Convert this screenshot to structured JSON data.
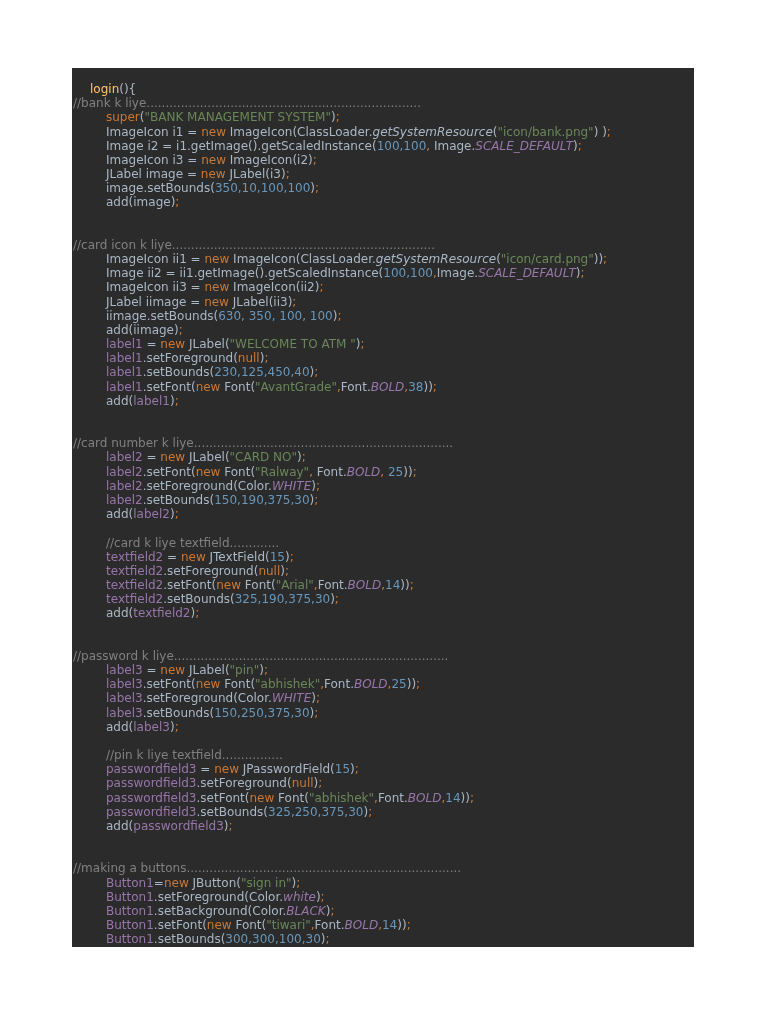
{
  "editor": {
    "lines": [
      {
        "kind": "header",
        "tokens": [
          {
            "kind": "function",
            "text": "login"
          },
          {
            "kind": "plain",
            "text": "(){"
          }
        ]
      },
      {
        "kind": "comment",
        "tokens": [
          {
            "kind": "comment",
            "text": "//bank k liye........................................................................"
          }
        ]
      },
      {
        "kind": "code",
        "tokens": [
          {
            "kind": "keyword",
            "text": "super"
          },
          {
            "kind": "plain",
            "text": "("
          },
          {
            "kind": "string",
            "text": "\"BANK MANAGEMENT SYSTEM\""
          },
          {
            "kind": "plain",
            "text": ")"
          },
          {
            "kind": "punct",
            "text": ";"
          }
        ]
      },
      {
        "kind": "code",
        "tokens": [
          {
            "kind": "plain",
            "text": "ImageIcon i1 = "
          },
          {
            "kind": "keyword",
            "text": "new"
          },
          {
            "kind": "plain",
            "text": " ImageIcon(ClassLoader."
          },
          {
            "kind": "method",
            "text": "getSystemResource"
          },
          {
            "kind": "plain",
            "text": "("
          },
          {
            "kind": "string",
            "text": "\"icon/bank.png\""
          },
          {
            "kind": "plain",
            "text": ") )"
          },
          {
            "kind": "punct",
            "text": ";"
          }
        ]
      },
      {
        "kind": "code",
        "tokens": [
          {
            "kind": "plain",
            "text": "Image i2 = i1.getImage().getScaledInstance("
          },
          {
            "kind": "number",
            "text": "100,100"
          },
          {
            "kind": "punct",
            "text": ","
          },
          {
            "kind": "plain",
            "text": " Image."
          },
          {
            "kind": "constant",
            "text": "SCALE_DEFAULT"
          },
          {
            "kind": "plain",
            "text": ")"
          },
          {
            "kind": "punct",
            "text": ";"
          }
        ]
      },
      {
        "kind": "code",
        "tokens": [
          {
            "kind": "plain",
            "text": "ImageIcon i3 = "
          },
          {
            "kind": "keyword",
            "text": "new"
          },
          {
            "kind": "plain",
            "text": " ImageIcon(i2)"
          },
          {
            "kind": "punct",
            "text": ";"
          }
        ]
      },
      {
        "kind": "code",
        "tokens": [
          {
            "kind": "plain",
            "text": "JLabel image = "
          },
          {
            "kind": "keyword",
            "text": "new"
          },
          {
            "kind": "plain",
            "text": " JLabel(i3)"
          },
          {
            "kind": "punct",
            "text": ";"
          }
        ]
      },
      {
        "kind": "code",
        "tokens": [
          {
            "kind": "plain",
            "text": "image.setBounds("
          },
          {
            "kind": "number",
            "text": "350,10,100,100"
          },
          {
            "kind": "plain",
            "text": ")"
          },
          {
            "kind": "punct",
            "text": ";"
          }
        ]
      },
      {
        "kind": "code",
        "tokens": [
          {
            "kind": "plain",
            "text": "add(image)"
          },
          {
            "kind": "punct",
            "text": ";"
          }
        ]
      },
      {
        "kind": "blank"
      },
      {
        "kind": "blank"
      },
      {
        "kind": "comment",
        "tokens": [
          {
            "kind": "comment",
            "text": "//card icon k liye....................................................................."
          }
        ]
      },
      {
        "kind": "code",
        "tokens": [
          {
            "kind": "plain",
            "text": "ImageIcon ii1 = "
          },
          {
            "kind": "keyword",
            "text": "new"
          },
          {
            "kind": "plain",
            "text": " ImageIcon(ClassLoader."
          },
          {
            "kind": "method",
            "text": "getSystemResource"
          },
          {
            "kind": "plain",
            "text": "("
          },
          {
            "kind": "string",
            "text": "\"icon/card.png\""
          },
          {
            "kind": "plain",
            "text": "))"
          },
          {
            "kind": "punct",
            "text": ";"
          }
        ]
      },
      {
        "kind": "code",
        "tokens": [
          {
            "kind": "plain",
            "text": "Image ii2 = ii1.getImage().getScaledInstance("
          },
          {
            "kind": "number",
            "text": "100,100"
          },
          {
            "kind": "punct",
            "text": ","
          },
          {
            "kind": "plain",
            "text": "Image."
          },
          {
            "kind": "constant",
            "text": "SCALE_DEFAULT"
          },
          {
            "kind": "plain",
            "text": ")"
          },
          {
            "kind": "punct",
            "text": ";"
          }
        ]
      },
      {
        "kind": "code",
        "tokens": [
          {
            "kind": "plain",
            "text": "ImageIcon ii3 = "
          },
          {
            "kind": "keyword",
            "text": "new"
          },
          {
            "kind": "plain",
            "text": " ImageIcon(ii2)"
          },
          {
            "kind": "punct",
            "text": ";"
          }
        ]
      },
      {
        "kind": "code",
        "tokens": [
          {
            "kind": "plain",
            "text": "JLabel iimage = "
          },
          {
            "kind": "keyword",
            "text": "new"
          },
          {
            "kind": "plain",
            "text": " JLabel(ii3)"
          },
          {
            "kind": "punct",
            "text": ";"
          }
        ]
      },
      {
        "kind": "code",
        "tokens": [
          {
            "kind": "plain",
            "text": "iimage.setBounds("
          },
          {
            "kind": "number",
            "text": "630, 350, 100, 100"
          },
          {
            "kind": "plain",
            "text": ")"
          },
          {
            "kind": "punct",
            "text": ";"
          }
        ]
      },
      {
        "kind": "code",
        "tokens": [
          {
            "kind": "plain",
            "text": "add(iimage)"
          },
          {
            "kind": "punct",
            "text": ";"
          }
        ]
      },
      {
        "kind": "code",
        "tokens": [
          {
            "kind": "field",
            "text": "label1"
          },
          {
            "kind": "plain",
            "text": " = "
          },
          {
            "kind": "keyword",
            "text": "new"
          },
          {
            "kind": "plain",
            "text": " JLabel("
          },
          {
            "kind": "string",
            "text": "\"WELCOME TO ATM \""
          },
          {
            "kind": "plain",
            "text": ")"
          },
          {
            "kind": "punct",
            "text": ";"
          }
        ]
      },
      {
        "kind": "code",
        "tokens": [
          {
            "kind": "field",
            "text": "label1"
          },
          {
            "kind": "plain",
            "text": ".setForeground("
          },
          {
            "kind": "keyword",
            "text": "null"
          },
          {
            "kind": "plain",
            "text": ")"
          },
          {
            "kind": "punct",
            "text": ";"
          }
        ]
      },
      {
        "kind": "code",
        "tokens": [
          {
            "kind": "field",
            "text": "label1"
          },
          {
            "kind": "plain",
            "text": ".setBounds("
          },
          {
            "kind": "number",
            "text": "230,125,450,40"
          },
          {
            "kind": "plain",
            "text": ")"
          },
          {
            "kind": "punct",
            "text": ";"
          }
        ]
      },
      {
        "kind": "code",
        "tokens": [
          {
            "kind": "field",
            "text": "label1"
          },
          {
            "kind": "plain",
            "text": ".setFont("
          },
          {
            "kind": "keyword",
            "text": "new"
          },
          {
            "kind": "plain",
            "text": " Font("
          },
          {
            "kind": "string",
            "text": "\"AvantGrade\""
          },
          {
            "kind": "punct",
            "text": ","
          },
          {
            "kind": "plain",
            "text": "Font."
          },
          {
            "kind": "constant",
            "text": "BOLD"
          },
          {
            "kind": "punct",
            "text": ","
          },
          {
            "kind": "number",
            "text": "38"
          },
          {
            "kind": "plain",
            "text": "))"
          },
          {
            "kind": "punct",
            "text": ";"
          }
        ]
      },
      {
        "kind": "code",
        "tokens": [
          {
            "kind": "plain",
            "text": "add("
          },
          {
            "kind": "field",
            "text": "label1"
          },
          {
            "kind": "plain",
            "text": ")"
          },
          {
            "kind": "punct",
            "text": ";"
          }
        ]
      },
      {
        "kind": "blank"
      },
      {
        "kind": "blank"
      },
      {
        "kind": "comment",
        "tokens": [
          {
            "kind": "comment",
            "text": "//card number k liye...................................................................."
          }
        ]
      },
      {
        "kind": "code",
        "tokens": [
          {
            "kind": "field",
            "text": "label2"
          },
          {
            "kind": "plain",
            "text": " = "
          },
          {
            "kind": "keyword",
            "text": "new"
          },
          {
            "kind": "plain",
            "text": " JLabel("
          },
          {
            "kind": "string",
            "text": "\"CARD NO\""
          },
          {
            "kind": "plain",
            "text": ")"
          },
          {
            "kind": "punct",
            "text": ";"
          }
        ]
      },
      {
        "kind": "code",
        "tokens": [
          {
            "kind": "field",
            "text": "label2"
          },
          {
            "kind": "plain",
            "text": ".setFont("
          },
          {
            "kind": "keyword",
            "text": "new"
          },
          {
            "kind": "plain",
            "text": " Font("
          },
          {
            "kind": "string",
            "text": "\"Ralway\""
          },
          {
            "kind": "punct",
            "text": ","
          },
          {
            "kind": "plain",
            "text": " Font."
          },
          {
            "kind": "constant",
            "text": "BOLD"
          },
          {
            "kind": "punct",
            "text": ","
          },
          {
            "kind": "number",
            "text": " 25"
          },
          {
            "kind": "plain",
            "text": "))"
          },
          {
            "kind": "punct",
            "text": ";"
          }
        ]
      },
      {
        "kind": "code",
        "tokens": [
          {
            "kind": "field",
            "text": "label2"
          },
          {
            "kind": "plain",
            "text": ".setForeground(Color."
          },
          {
            "kind": "constant",
            "text": "WHITE"
          },
          {
            "kind": "plain",
            "text": ")"
          },
          {
            "kind": "punct",
            "text": ";"
          }
        ]
      },
      {
        "kind": "code",
        "tokens": [
          {
            "kind": "field",
            "text": "label2"
          },
          {
            "kind": "plain",
            "text": ".setBounds("
          },
          {
            "kind": "number",
            "text": "150,190,375,30"
          },
          {
            "kind": "plain",
            "text": ")"
          },
          {
            "kind": "punct",
            "text": ";"
          }
        ]
      },
      {
        "kind": "code",
        "tokens": [
          {
            "kind": "plain",
            "text": "add("
          },
          {
            "kind": "field",
            "text": "label2"
          },
          {
            "kind": "plain",
            "text": ")"
          },
          {
            "kind": "punct",
            "text": ";"
          }
        ]
      },
      {
        "kind": "blank"
      },
      {
        "kind": "code",
        "tokens": [
          {
            "kind": "comment",
            "text": "//card k liye textfield............."
          }
        ]
      },
      {
        "kind": "code",
        "tokens": [
          {
            "kind": "field",
            "text": "textfield2"
          },
          {
            "kind": "plain",
            "text": " = "
          },
          {
            "kind": "keyword",
            "text": "new"
          },
          {
            "kind": "plain",
            "text": " JTextField("
          },
          {
            "kind": "number",
            "text": "15"
          },
          {
            "kind": "plain",
            "text": ")"
          },
          {
            "kind": "punct",
            "text": ";"
          }
        ]
      },
      {
        "kind": "code",
        "tokens": [
          {
            "kind": "field",
            "text": "textfield2"
          },
          {
            "kind": "plain",
            "text": ".setForeground("
          },
          {
            "kind": "keyword",
            "text": "null"
          },
          {
            "kind": "plain",
            "text": ")"
          },
          {
            "kind": "punct",
            "text": ";"
          }
        ]
      },
      {
        "kind": "code",
        "tokens": [
          {
            "kind": "field",
            "text": "textfield2"
          },
          {
            "kind": "plain",
            "text": ".setFont("
          },
          {
            "kind": "keyword",
            "text": "new"
          },
          {
            "kind": "plain",
            "text": " Font("
          },
          {
            "kind": "string",
            "text": "\"Arial\""
          },
          {
            "kind": "punct",
            "text": ","
          },
          {
            "kind": "plain",
            "text": "Font."
          },
          {
            "kind": "constant",
            "text": "BOLD"
          },
          {
            "kind": "punct",
            "text": ","
          },
          {
            "kind": "number",
            "text": "14"
          },
          {
            "kind": "plain",
            "text": "))"
          },
          {
            "kind": "punct",
            "text": ";"
          }
        ]
      },
      {
        "kind": "code",
        "tokens": [
          {
            "kind": "field",
            "text": "textfield2"
          },
          {
            "kind": "plain",
            "text": ".setBounds("
          },
          {
            "kind": "number",
            "text": "325,190,375,30"
          },
          {
            "kind": "plain",
            "text": ")"
          },
          {
            "kind": "punct",
            "text": ";"
          }
        ]
      },
      {
        "kind": "code",
        "tokens": [
          {
            "kind": "plain",
            "text": "add("
          },
          {
            "kind": "field",
            "text": "textfield2"
          },
          {
            "kind": "plain",
            "text": ")"
          },
          {
            "kind": "punct",
            "text": ";"
          }
        ]
      },
      {
        "kind": "blank"
      },
      {
        "kind": "blank"
      },
      {
        "kind": "comment",
        "tokens": [
          {
            "kind": "comment",
            "text": "//password k liye........................................................................"
          }
        ]
      },
      {
        "kind": "code",
        "tokens": [
          {
            "kind": "field",
            "text": "label3"
          },
          {
            "kind": "plain",
            "text": " = "
          },
          {
            "kind": "keyword",
            "text": "new"
          },
          {
            "kind": "plain",
            "text": " JLabel("
          },
          {
            "kind": "string",
            "text": "\"pin\""
          },
          {
            "kind": "plain",
            "text": ")"
          },
          {
            "kind": "punct",
            "text": ";"
          }
        ]
      },
      {
        "kind": "code",
        "tokens": [
          {
            "kind": "field",
            "text": "label3"
          },
          {
            "kind": "plain",
            "text": ".setFont("
          },
          {
            "kind": "keyword",
            "text": "new"
          },
          {
            "kind": "plain",
            "text": " Font("
          },
          {
            "kind": "string",
            "text": "\"abhishek\""
          },
          {
            "kind": "punct",
            "text": ","
          },
          {
            "kind": "plain",
            "text": "Font."
          },
          {
            "kind": "constant",
            "text": "BOLD"
          },
          {
            "kind": "punct",
            "text": ","
          },
          {
            "kind": "number",
            "text": "25"
          },
          {
            "kind": "plain",
            "text": "))"
          },
          {
            "kind": "punct",
            "text": ";"
          }
        ]
      },
      {
        "kind": "code",
        "tokens": [
          {
            "kind": "field",
            "text": "label3"
          },
          {
            "kind": "plain",
            "text": ".setForeground(Color."
          },
          {
            "kind": "constant",
            "text": "WHITE"
          },
          {
            "kind": "plain",
            "text": ")"
          },
          {
            "kind": "punct",
            "text": ";"
          }
        ]
      },
      {
        "kind": "code",
        "tokens": [
          {
            "kind": "field",
            "text": "label3"
          },
          {
            "kind": "plain",
            "text": ".setBounds("
          },
          {
            "kind": "number",
            "text": "150,250,375,30"
          },
          {
            "kind": "plain",
            "text": ")"
          },
          {
            "kind": "punct",
            "text": ";"
          }
        ]
      },
      {
        "kind": "code",
        "tokens": [
          {
            "kind": "plain",
            "text": "add("
          },
          {
            "kind": "field",
            "text": "label3"
          },
          {
            "kind": "plain",
            "text": ")"
          },
          {
            "kind": "punct",
            "text": ";"
          }
        ]
      },
      {
        "kind": "blank"
      },
      {
        "kind": "code",
        "tokens": [
          {
            "kind": "comment",
            "text": "//pin k liye textfield................"
          }
        ]
      },
      {
        "kind": "code",
        "tokens": [
          {
            "kind": "field",
            "text": "passwordfield3"
          },
          {
            "kind": "plain",
            "text": " = "
          },
          {
            "kind": "keyword",
            "text": "new"
          },
          {
            "kind": "plain",
            "text": " JPasswordField("
          },
          {
            "kind": "number",
            "text": "15"
          },
          {
            "kind": "plain",
            "text": ")"
          },
          {
            "kind": "punct",
            "text": ";"
          }
        ]
      },
      {
        "kind": "code",
        "tokens": [
          {
            "kind": "field",
            "text": "passwordfield3"
          },
          {
            "kind": "plain",
            "text": ".setForeground("
          },
          {
            "kind": "keyword",
            "text": "null"
          },
          {
            "kind": "plain",
            "text": ")"
          },
          {
            "kind": "punct",
            "text": ";"
          }
        ]
      },
      {
        "kind": "code",
        "tokens": [
          {
            "kind": "field",
            "text": "passwordfield3"
          },
          {
            "kind": "plain",
            "text": ".setFont("
          },
          {
            "kind": "keyword",
            "text": "new"
          },
          {
            "kind": "plain",
            "text": " Font("
          },
          {
            "kind": "string",
            "text": "\"abhishek\""
          },
          {
            "kind": "punct",
            "text": ","
          },
          {
            "kind": "plain",
            "text": "Font."
          },
          {
            "kind": "constant",
            "text": "BOLD"
          },
          {
            "kind": "punct",
            "text": ","
          },
          {
            "kind": "number",
            "text": "14"
          },
          {
            "kind": "plain",
            "text": "))"
          },
          {
            "kind": "punct",
            "text": ";"
          }
        ]
      },
      {
        "kind": "code",
        "tokens": [
          {
            "kind": "field",
            "text": "passwordfield3"
          },
          {
            "kind": "plain",
            "text": ".setBounds("
          },
          {
            "kind": "number",
            "text": "325,250,375,30"
          },
          {
            "kind": "plain",
            "text": ")"
          },
          {
            "kind": "punct",
            "text": ";"
          }
        ]
      },
      {
        "kind": "code",
        "tokens": [
          {
            "kind": "plain",
            "text": "add("
          },
          {
            "kind": "field",
            "text": "passwordfield3"
          },
          {
            "kind": "plain",
            "text": ")"
          },
          {
            "kind": "punct",
            "text": ";"
          }
        ]
      },
      {
        "kind": "blank"
      },
      {
        "kind": "blank"
      },
      {
        "kind": "comment",
        "tokens": [
          {
            "kind": "comment",
            "text": "//making a buttons........................................................................"
          }
        ]
      },
      {
        "kind": "code",
        "tokens": [
          {
            "kind": "field",
            "text": "Button1"
          },
          {
            "kind": "plain",
            "text": "="
          },
          {
            "kind": "keyword",
            "text": "new"
          },
          {
            "kind": "plain",
            "text": " JButton("
          },
          {
            "kind": "string",
            "text": "\"sign in\""
          },
          {
            "kind": "plain",
            "text": ")"
          },
          {
            "kind": "punct",
            "text": ";"
          }
        ]
      },
      {
        "kind": "code",
        "tokens": [
          {
            "kind": "field",
            "text": "Button1"
          },
          {
            "kind": "plain",
            "text": ".setForeground(Color."
          },
          {
            "kind": "constant",
            "text": "white"
          },
          {
            "kind": "plain",
            "text": ")"
          },
          {
            "kind": "punct",
            "text": ";"
          }
        ]
      },
      {
        "kind": "code",
        "tokens": [
          {
            "kind": "field",
            "text": "Button1"
          },
          {
            "kind": "plain",
            "text": ".setBackground(Color."
          },
          {
            "kind": "constant",
            "text": "BLACK"
          },
          {
            "kind": "plain",
            "text": ")"
          },
          {
            "kind": "punct",
            "text": ";"
          }
        ]
      },
      {
        "kind": "code",
        "tokens": [
          {
            "kind": "field",
            "text": "Button1"
          },
          {
            "kind": "plain",
            "text": ".setFont("
          },
          {
            "kind": "keyword",
            "text": "new"
          },
          {
            "kind": "plain",
            "text": " Font("
          },
          {
            "kind": "string",
            "text": "\"tiwari\""
          },
          {
            "kind": "punct",
            "text": ","
          },
          {
            "kind": "plain",
            "text": "Font."
          },
          {
            "kind": "constant",
            "text": "BOLD"
          },
          {
            "kind": "punct",
            "text": ","
          },
          {
            "kind": "number",
            "text": "14"
          },
          {
            "kind": "plain",
            "text": "))"
          },
          {
            "kind": "punct",
            "text": ";"
          }
        ]
      },
      {
        "kind": "code",
        "tokens": [
          {
            "kind": "field",
            "text": "Button1"
          },
          {
            "kind": "plain",
            "text": ".setBounds("
          },
          {
            "kind": "number",
            "text": "300,300,100,30"
          },
          {
            "kind": "plain",
            "text": ")"
          },
          {
            "kind": "punct",
            "text": ";"
          }
        ]
      }
    ]
  }
}
